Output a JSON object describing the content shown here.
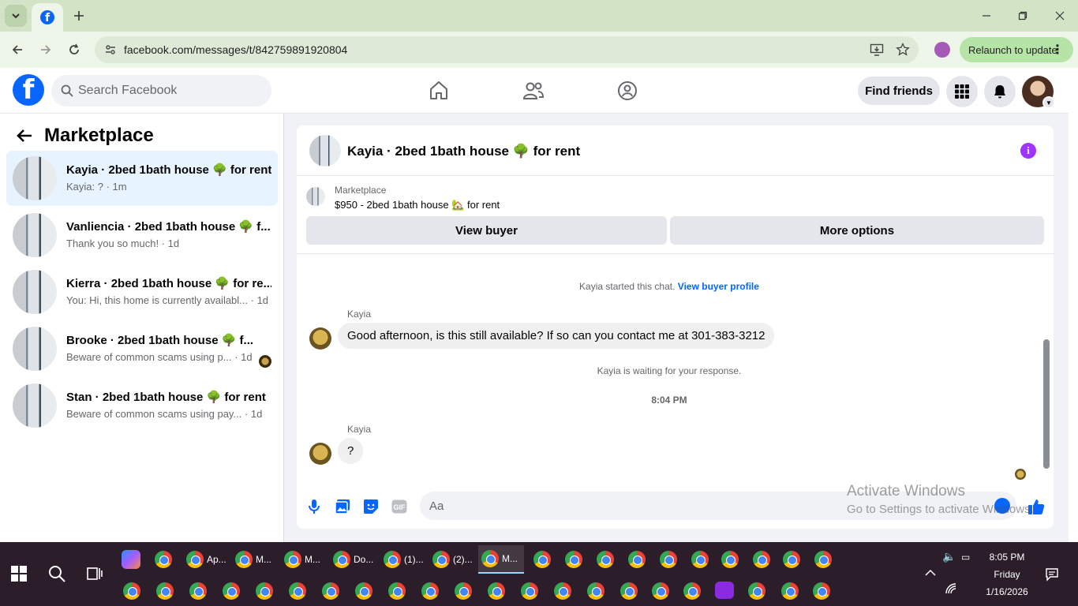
{
  "browser": {
    "url": "facebook.com/messages/t/842759891920804",
    "relaunch_label": "Relaunch to update"
  },
  "header": {
    "search_placeholder": "Search Facebook",
    "find_friends_label": "Find friends"
  },
  "sidebar": {
    "title": "Marketplace",
    "conversations": [
      {
        "name": "Kayia · 2bed 1bath house 🌳 for rent",
        "snippet": "Kayia: ? · 1m"
      },
      {
        "name": "Vanliencia · 2bed 1bath house 🌳 f...",
        "snippet": "Thank you so much! · 1d"
      },
      {
        "name": "Kierra · 2bed 1bath house 🌳 for re...",
        "snippet": "You: Hi, this home is currently availabl... · 1d"
      },
      {
        "name": "Brooke · 2bed 1bath house 🌳 f...",
        "snippet": "Beware of common scams using p... · 1d"
      },
      {
        "name": "Stan · 2bed 1bath house 🌳 for rent",
        "snippet": "Beware of common scams using pay... · 1d"
      }
    ]
  },
  "chat": {
    "title": "Kayia · 2bed 1bath house 🌳 for rent",
    "marketplace_label": "Marketplace",
    "listing": "$950 - 2bed 1bath house 🏡 for rent",
    "view_buyer_label": "View buyer",
    "more_options_label": "More options",
    "started_text": "Kayia started this chat.",
    "view_profile_link": "View buyer profile",
    "messages": [
      {
        "sender": "Kayia",
        "text": "Good afternoon, is this still available? If so can you contact me at 301-383-3212"
      },
      {
        "sender": "Kayia",
        "text": "?"
      }
    ],
    "waiting_text": "Kayia is waiting for your response.",
    "timestamp": "8:04 PM",
    "input_placeholder": "Aa"
  },
  "watermark": {
    "line1": "Activate Windows",
    "line2": "Go to Settings to activate Windows."
  },
  "taskbar": {
    "apps": [
      {
        "label": "Ap..."
      },
      {
        "label": "M..."
      },
      {
        "label": "M..."
      },
      {
        "label": "Do..."
      },
      {
        "label": "(1)..."
      },
      {
        "label": "(2)..."
      },
      {
        "label": "M..."
      }
    ],
    "time": "8:05 PM",
    "day": "Friday",
    "date": "1/16/2026"
  },
  "colors": {
    "facebook_blue": "#0866ff",
    "active_conversation": "#e7f3ff",
    "info_purple": "#a033ff"
  }
}
